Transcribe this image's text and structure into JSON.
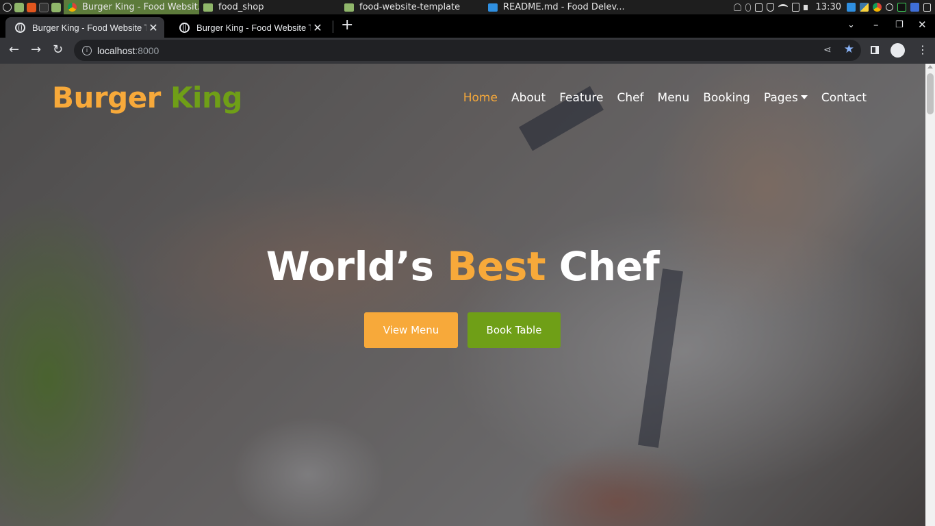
{
  "os_panel": {
    "tasks": [
      {
        "label": "Burger King - Food Websit...",
        "active": true
      },
      {
        "label": "food_shop",
        "active": false
      },
      {
        "label": "food-website-template",
        "active": false
      },
      {
        "label": "README.md - Food Delev...",
        "active": false
      }
    ],
    "clock": "13:30"
  },
  "browser": {
    "tabs": [
      {
        "title": "Burger King - Food Website Te",
        "active": true
      },
      {
        "title": "Burger King - Food Website Te",
        "active": false
      }
    ],
    "url_host": "localhost",
    "url_port": ":8000"
  },
  "site": {
    "brand_part1": "Burger",
    "brand_part2": "King",
    "nav": [
      "Home",
      "About",
      "Feature",
      "Chef",
      "Menu",
      "Booking",
      "Pages",
      "Contact"
    ],
    "hero_title_1": "World’s",
    "hero_title_accent": "Best",
    "hero_title_2": "Chef",
    "btn_view_menu": "View Menu",
    "btn_book_table": "Book Table"
  },
  "colors": {
    "brand_orange": "#f7a93a",
    "brand_green": "#6f9f17"
  }
}
